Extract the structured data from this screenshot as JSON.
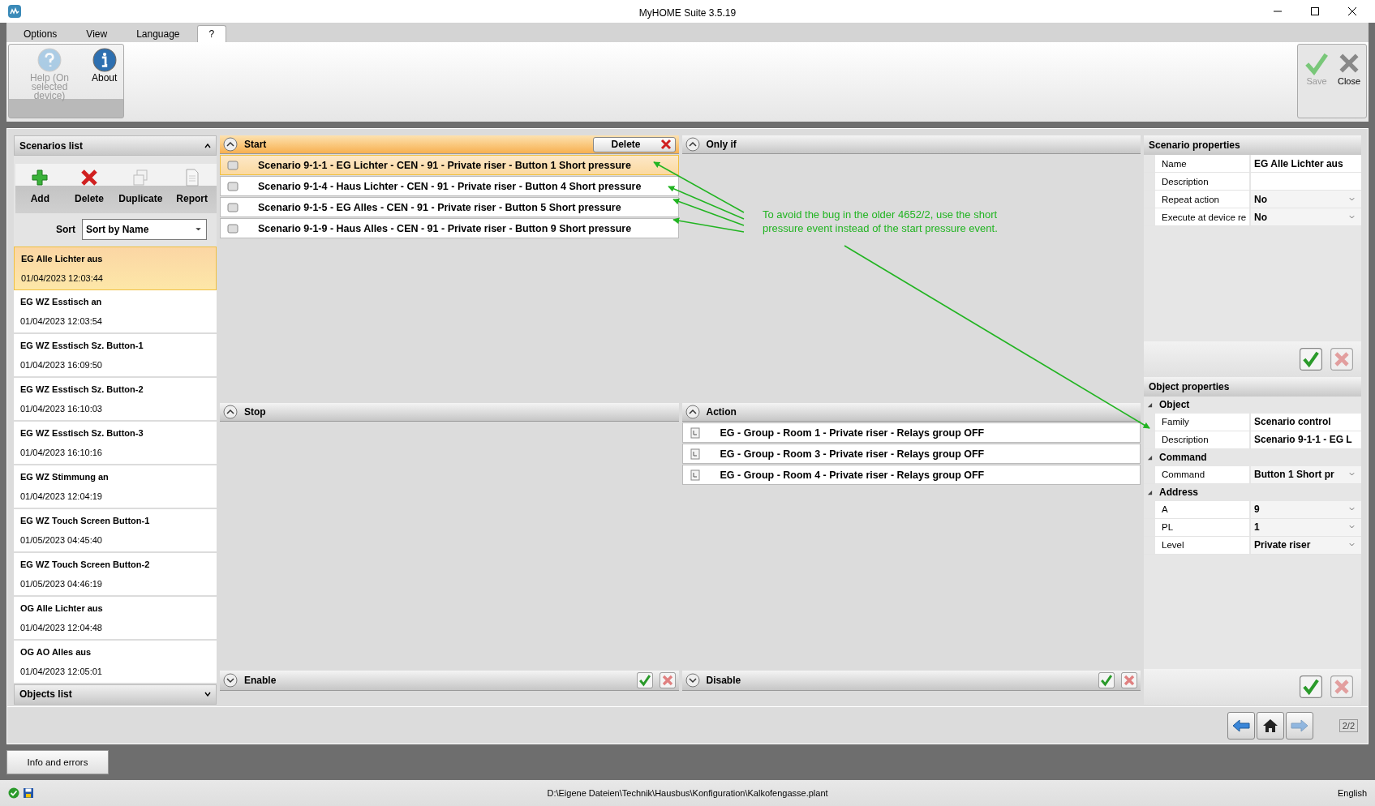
{
  "window": {
    "title": "MyHOME Suite 3.5.19"
  },
  "menu_tabs": [
    {
      "label": "Options",
      "selected": false
    },
    {
      "label": "View",
      "selected": false
    },
    {
      "label": "Language",
      "selected": false
    },
    {
      "label": "?",
      "selected": true
    }
  ],
  "ribbon_left": [
    {
      "label": "Help (On selected device)",
      "kind": "help",
      "disabled": true
    },
    {
      "label": "About",
      "kind": "info",
      "disabled": false
    }
  ],
  "ribbon_right": [
    {
      "label": "Save",
      "kind": "save",
      "disabled": true
    },
    {
      "label": "Close",
      "kind": "close",
      "disabled": false
    }
  ],
  "scenarios_list": {
    "title": "Scenarios list",
    "tools": [
      {
        "label": "Add",
        "kind": "add"
      },
      {
        "label": "Delete",
        "kind": "delete"
      },
      {
        "label": "Duplicate",
        "kind": "duplicate"
      },
      {
        "label": "Report",
        "kind": "report"
      }
    ],
    "sort_label": "Sort",
    "sort_value": "Sort by Name",
    "items": [
      {
        "name": "EG Alle Lichter aus",
        "date": "01/04/2023 12:03:44",
        "selected": true
      },
      {
        "name": "EG WZ Esstisch an",
        "date": "01/04/2023 12:03:54",
        "selected": false
      },
      {
        "name": "EG WZ Esstisch Sz. Button-1",
        "date": "01/04/2023 16:09:50",
        "selected": false
      },
      {
        "name": "EG WZ Esstisch Sz. Button-2",
        "date": "01/04/2023 16:10:03",
        "selected": false
      },
      {
        "name": "EG WZ Esstisch Sz. Button-3",
        "date": "01/04/2023 16:10:16",
        "selected": false
      },
      {
        "name": "EG WZ Stimmung an",
        "date": "01/04/2023 12:04:19",
        "selected": false
      },
      {
        "name": "EG WZ Touch Screen Button-1",
        "date": "01/05/2023 04:45:40",
        "selected": false
      },
      {
        "name": "EG WZ Touch Screen Button-2",
        "date": "01/05/2023 04:46:19",
        "selected": false
      },
      {
        "name": "OG Alle Lichter aus",
        "date": "01/04/2023 12:04:48",
        "selected": false
      },
      {
        "name": "OG AO Alles aus",
        "date": "01/04/2023 12:05:01",
        "selected": false
      }
    ]
  },
  "objects_list": {
    "title": "Objects list"
  },
  "start": {
    "title": "Start",
    "delete_label": "Delete",
    "rows": [
      {
        "label": "Scenario 9-1-1 - EG Lichter - CEN - 91 - Private riser - Button 1 Short pressure",
        "selected": true
      },
      {
        "label": "Scenario 9-1-4 - Haus Lichter - CEN - 91 - Private riser - Button 4 Short pressure",
        "selected": false
      },
      {
        "label": "Scenario 9-1-5 - EG Alles - CEN - 91 - Private riser - Button 5 Short pressure",
        "selected": false
      },
      {
        "label": "Scenario 9-1-9 - Haus Alles - CEN - 91 - Private riser - Button 9 Short pressure",
        "selected": false
      }
    ]
  },
  "only_if": {
    "title": "Only if"
  },
  "stop": {
    "title": "Stop"
  },
  "action": {
    "title": "Action",
    "rows": [
      {
        "label": "EG - Group - Room 1 - Private riser - Relays group OFF"
      },
      {
        "label": "EG - Group - Room 3 - Private riser - Relays group OFF"
      },
      {
        "label": "EG - Group - Room 4 - Private riser - Relays group OFF"
      }
    ]
  },
  "enable": {
    "title": "Enable"
  },
  "disable": {
    "title": "Disable"
  },
  "annotation": "To avoid the bug in the older 4652/2, use the short pressure event instead of the start pressure event.",
  "scenario_properties": {
    "title": "Scenario properties",
    "rows": [
      {
        "label": "Name",
        "value": "EG Alle Lichter aus",
        "kind": "text"
      },
      {
        "label": "Description",
        "kind": "text"
      },
      {
        "label": "Repeat action",
        "value": "No",
        "kind": "dropdown"
      },
      {
        "label": "Execute at device re",
        "value": "No",
        "kind": "dropdown"
      }
    ]
  },
  "object_properties": {
    "title": "Object properties",
    "groups": [
      {
        "label": "Object",
        "expanded": true,
        "rows": [
          {
            "label": "Family",
            "value": "Scenario control",
            "kind": "text"
          },
          {
            "label": "Description",
            "value": "Scenario 9-1-1 - EG L",
            "kind": "text"
          }
        ]
      },
      {
        "label": "Command",
        "expanded": true,
        "rows": [
          {
            "label": "Command",
            "value": "Button 1 Short pr",
            "kind": "dropdown"
          }
        ]
      },
      {
        "label": "Address",
        "expanded": true,
        "rows": [
          {
            "label": "A",
            "value": "9",
            "kind": "dropdown"
          },
          {
            "label": "PL",
            "value": "1",
            "kind": "dropdown"
          },
          {
            "label": "Level",
            "value": "Private riser",
            "kind": "dropdown"
          }
        ]
      }
    ]
  },
  "nav": [
    {
      "kind": "back",
      "disabled": false
    },
    {
      "kind": "home",
      "disabled": false
    },
    {
      "kind": "forward",
      "disabled": true
    }
  ],
  "page_indicator": "2/2",
  "info_button": "Info and errors",
  "status_bar": {
    "path": "D:\\Eigene Dateien\\Technik\\Hausbus\\Konfiguration\\Kalkofengasse.plant",
    "language": "English"
  }
}
